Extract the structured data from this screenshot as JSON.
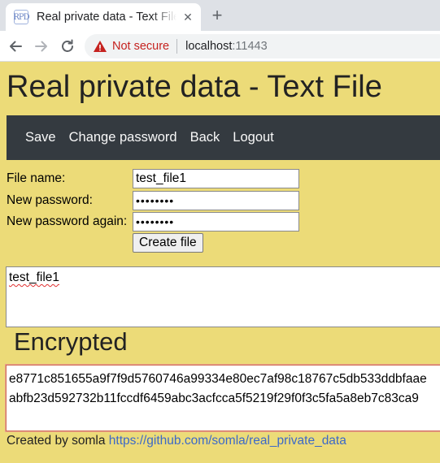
{
  "browser": {
    "favicon_text": "RPD",
    "tab_title": "Real private data - Text File",
    "tab_close": "✕",
    "new_tab": "+",
    "security_label": "Not secure",
    "host": "localhost",
    "port": ":11443"
  },
  "page": {
    "title": "Real private data - Text File",
    "nav": [
      "Save",
      "Change password",
      "Back",
      "Logout"
    ],
    "form": {
      "file_name_label": "File name:",
      "file_name_value": "test_file1",
      "new_password_label": "New password:",
      "new_password_value": "password",
      "new_password_again_label": "New password again:",
      "new_password_again_value": "password",
      "create_button": "Create file"
    },
    "plaintext": "test_file1",
    "encrypted_heading": "Encrypted",
    "encrypted_lines": [
      "e8771c851655a9f7f9d5760746a99334e80ec7af98c18767c5db533ddbfaae",
      "abfb23d592732b11fccdf6459abc3acfcca5f5219f29f0f3c5fa5a8eb7c83ca9"
    ],
    "footer_text": "Created by somla ",
    "footer_link": "https://github.com/somla/real_private_data"
  }
}
